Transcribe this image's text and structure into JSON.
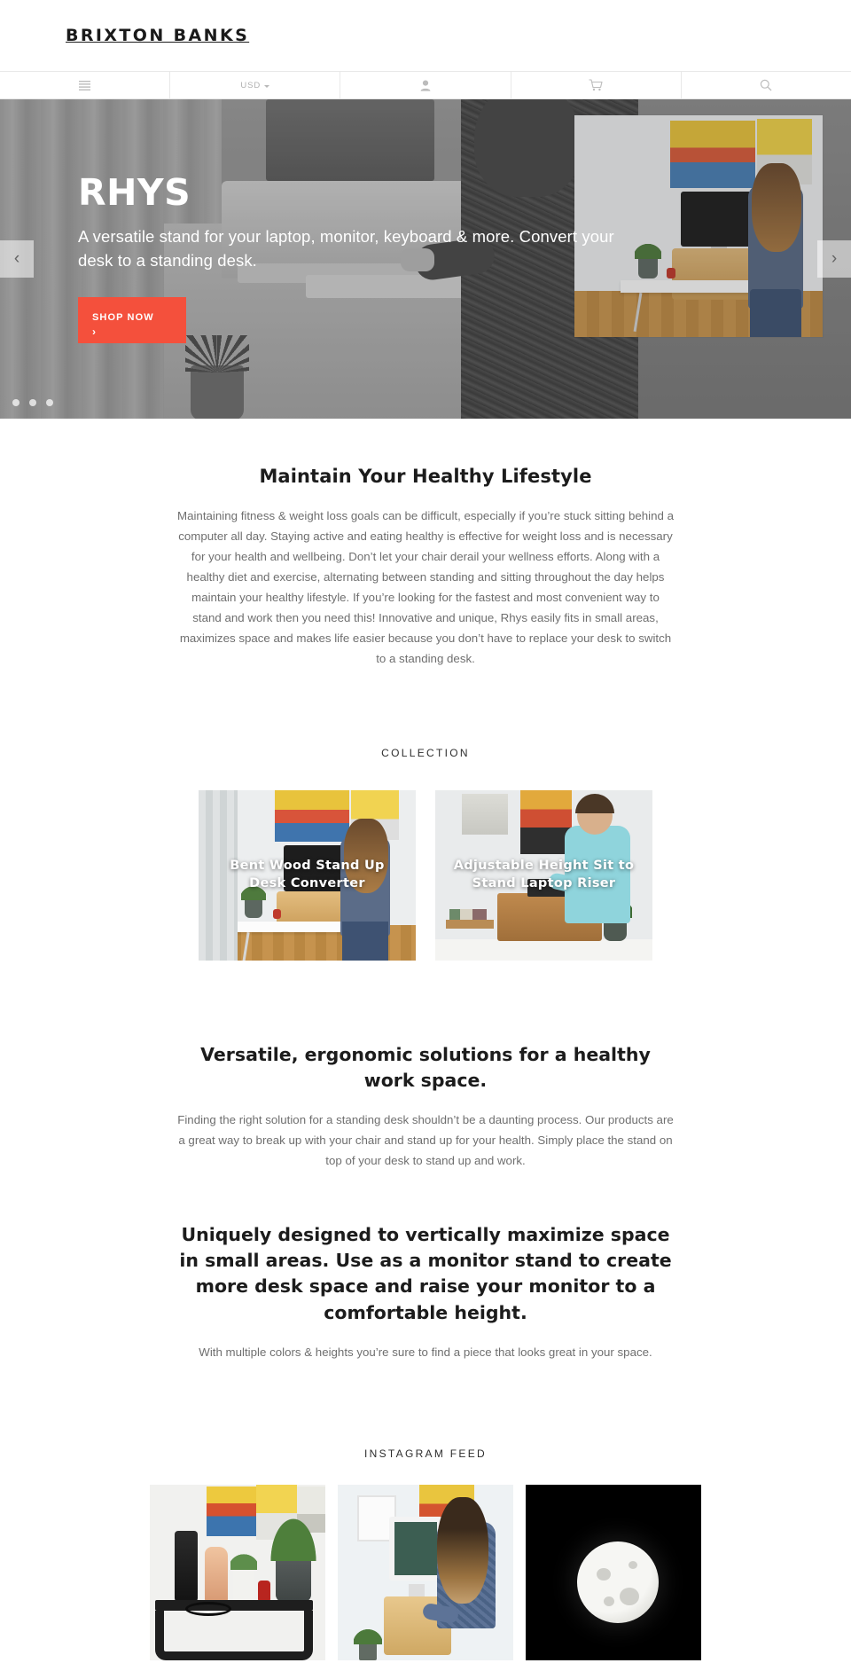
{
  "header": {
    "logo": "BRIXTON BANKS"
  },
  "nav": {
    "items": [
      {
        "name": "menu",
        "icon": "hamburger-icon",
        "label": ""
      },
      {
        "name": "currency",
        "icon": "chevron-down-icon",
        "label": "USD"
      },
      {
        "name": "account",
        "icon": "user-icon",
        "label": ""
      },
      {
        "name": "cart",
        "icon": "cart-icon",
        "label": ""
      },
      {
        "name": "search",
        "icon": "search-icon",
        "label": ""
      }
    ]
  },
  "hero": {
    "title": "RHYS",
    "subtitle": "A versatile stand for your laptop, monitor, keyboard & more. Convert your desk to a standing desk.",
    "cta_label": "SHOP NOW",
    "cta_chevron": "›",
    "prev_arrow": "‹",
    "next_arrow": "›",
    "slide_count": 3,
    "active_slide": 1,
    "accent_color": "#f4503c"
  },
  "intro": {
    "heading": "Maintain Your Healthy Lifestyle",
    "body": "Maintaining fitness &  weight loss goals can be difficult, especially if you’re stuck sitting behind a computer all day. Staying active and eating healthy is effective for weight loss and is necessary for your health and wellbeing. Don’t let your chair derail your wellness efforts. Along with a healthy diet and exercise, alternating between standing and sitting throughout the day helps maintain your healthy lifestyle. If you’re looking for the fastest and most convenient way to stand and work then you need this! Innovative and unique, Rhys easily fits in small areas, maximizes space and makes life easier because you don’t have to replace your desk to switch to a standing desk."
  },
  "collection": {
    "label": "COLLECTION",
    "cards": [
      {
        "title": "Bent Wood Stand Up Desk Converter"
      },
      {
        "title": "Adjustable Height Sit to Stand Laptop Riser"
      }
    ]
  },
  "value_props": [
    {
      "heading": "Versatile, ergonomic solutions for a healthy work space.",
      "body": "Finding the right solution for a standing desk shouldn’t be a daunting process. Our products are a great way to break up with your chair and stand up for your health. Simply place the stand on top of your desk to stand up and work."
    },
    {
      "heading": "Uniquely designed to vertically maximize space in small areas. Use as a monitor stand to create more desk space and raise your monitor to a comfortable height.",
      "body": "With multiple colors & heights you’re sure to find a piece that looks great in your space."
    }
  ],
  "instagram": {
    "label": "INSTAGRAM FEED",
    "tiles": [
      {
        "name": "instagram-tile-shelf-styling"
      },
      {
        "name": "instagram-tile-standing-desk"
      },
      {
        "name": "instagram-tile-moon"
      }
    ]
  }
}
